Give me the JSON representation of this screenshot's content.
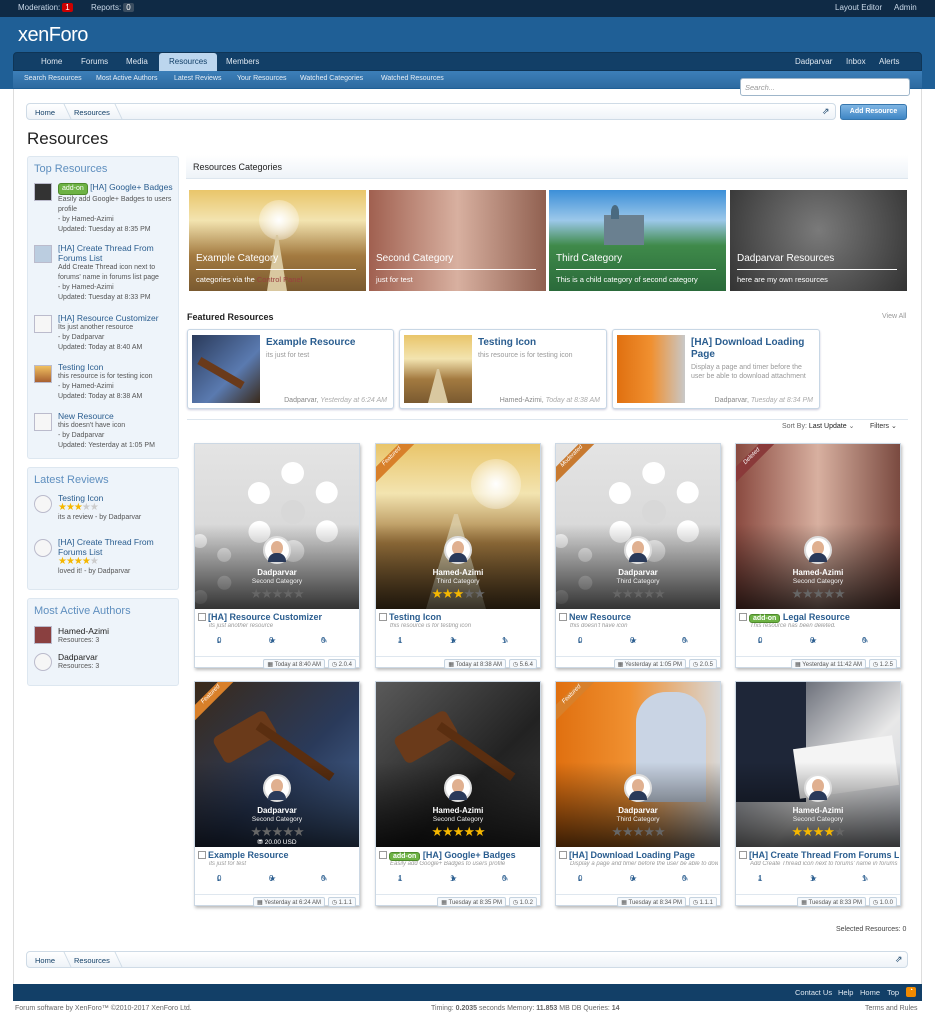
{
  "modbar": {
    "moderation_label": "Moderation:",
    "moderation_count": "1",
    "reports_label": "Reports:",
    "reports_count": "0",
    "layout_editor": "Layout Editor",
    "admin": "Admin"
  },
  "header": {
    "logo": "xenForo"
  },
  "nav": {
    "tabs": [
      "Home",
      "Forums",
      "Media",
      "Resources",
      "Members"
    ],
    "selected": "Resources",
    "user": "Dadparvar",
    "inbox": "Inbox",
    "alerts": "Alerts"
  },
  "subnav": [
    "Search Resources",
    "Most Active Authors",
    "Latest Reviews",
    "Your Resources",
    "Watched Categories",
    "Watched Resources"
  ],
  "search": {
    "placeholder": "Search..."
  },
  "breadcrumb": [
    "Home",
    "Resources"
  ],
  "add_button": "Add Resource",
  "page_title": "Resources",
  "sidebar": {
    "top_resources": {
      "title": "Top Resources",
      "items": [
        {
          "badge": "add-on",
          "title": "[HA] Google+ Badges",
          "desc": "Easily add Google+ Badges to users profile",
          "by": "- by Hamed-Azimi",
          "updated": "Updated: Tuesday at 8:35 PM"
        },
        {
          "title": "[HA] Create Thread From Forums List",
          "desc": "Add Create Thread icon next to forums' name in forums list page",
          "by": "- by Hamed-Azimi",
          "updated": "Updated: Tuesday at 8:33 PM"
        },
        {
          "title": "[HA] Resource Customizer",
          "desc": "Its just another resource",
          "by": "- by Dadparvar",
          "updated": "Updated: Today at 8:40 AM"
        },
        {
          "title": "Testing Icon",
          "desc": "this resource is for testing icon",
          "by": "- by Hamed-Azimi",
          "updated": "Updated: Today at 8:38 AM"
        },
        {
          "title": "New Resource",
          "desc": "this doesn't have icon",
          "by": "- by Dadparvar",
          "updated": "Updated: Yesterday at 1:05 PM"
        }
      ]
    },
    "latest_reviews": {
      "title": "Latest Reviews",
      "items": [
        {
          "title": "Testing Icon",
          "rating": 3,
          "text": "its a review",
          "by": "- by Dadparvar"
        },
        {
          "title": "[HA] Create Thread From Forums List",
          "rating": 4,
          "text": "loved it!",
          "by": "- by Dadparvar"
        }
      ]
    },
    "active_authors": {
      "title": "Most Active Authors",
      "items": [
        {
          "name": "Hamed-Azimi",
          "count": "Resources: 3"
        },
        {
          "name": "Dadparvar",
          "count": "Resources: 3"
        }
      ]
    }
  },
  "categories": {
    "title": "Resources Categories",
    "items": [
      {
        "name": "Example Category",
        "desc_prefix": "categories via the ",
        "desc_link": "Control Panel",
        "bg": "#c79a55"
      },
      {
        "name": "Second Category",
        "desc": "just for test",
        "bg": "#b98a7a"
      },
      {
        "name": "Third Category",
        "desc": "This is a child category of second category",
        "bg": "#4a9a6a"
      },
      {
        "name": "Dadparvar Resources",
        "desc": "here are my own resources",
        "bg": "#555555"
      }
    ]
  },
  "featured": {
    "title": "Featured Resources",
    "view_all": "View All",
    "items": [
      {
        "title": "Example Resource",
        "desc": "its just for test",
        "author": "Dadparvar,",
        "date": "Yesterday at 6:24 AM"
      },
      {
        "title": "Testing Icon",
        "desc": "this resource is for testing icon",
        "author": "Hamed-Azimi,",
        "date": "Today at 8:38 AM"
      },
      {
        "title": "[HA] Download Loading Page",
        "desc": "Display a page and timer before the user be able to download attachment",
        "author": "Dadparvar,",
        "date": "Tuesday at 8:34 PM"
      }
    ]
  },
  "sort": {
    "label": "Sort By:",
    "value": "Last Update",
    "filters": "Filters"
  },
  "resources": [
    {
      "title": "[HA] Resource Customizer",
      "desc": "its just another resource",
      "author": "Dadparvar",
      "category": "Second Category",
      "rating": 0,
      "downloads": "0",
      "reviews": "0",
      "updates": "0",
      "date": "Today at 8:40 AM",
      "version": "2.0.4",
      "ribbon": "",
      "badge": "",
      "price": "",
      "image": "gear"
    },
    {
      "title": "Testing Icon",
      "desc": "this resource is for testing icon",
      "author": "Hamed-Azimi",
      "category": "Third Category",
      "rating": 3,
      "downloads": "1",
      "reviews": "1",
      "updates": "1",
      "date": "Today at 8:38 AM",
      "version": "5.6.4",
      "ribbon": "Featured",
      "badge": "",
      "price": "",
      "image": "road"
    },
    {
      "title": "New Resource",
      "desc": "this doesn't have icon",
      "author": "Dadparvar",
      "category": "Third Category",
      "rating": 0,
      "downloads": "0",
      "reviews": "0",
      "updates": "0",
      "date": "Yesterday at 1:05 PM",
      "version": "2.0.5",
      "ribbon": "Moderated",
      "badge": "",
      "price": "",
      "image": "gear"
    },
    {
      "title": "Legal Resource",
      "desc": "This resource has been deleted.",
      "author": "Hamed-Azimi",
      "category": "Second Category",
      "rating": 0,
      "downloads": "0",
      "reviews": "0",
      "updates": "0",
      "date": "Yesterday at 11:42 AM",
      "version": "1.2.5",
      "ribbon": "Deleted",
      "badge": "add-on",
      "price": "",
      "image": "forest"
    },
    {
      "title": "Example Resource",
      "desc": "its just for test",
      "author": "Dadparvar",
      "category": "Second Category",
      "rating": 0,
      "downloads": "0",
      "reviews": "0",
      "updates": "0",
      "date": "Yesterday at 6:24 AM",
      "version": "1.1.1",
      "ribbon": "Featured",
      "badge": "",
      "price": "20.00 USD",
      "image": "gavel"
    },
    {
      "title": "[HA] Google+ Badges",
      "desc": "Easily add Google+ Badges to users profile",
      "author": "Hamed-Azimi",
      "category": "Second Category",
      "rating": 5,
      "downloads": "1",
      "reviews": "1",
      "updates": "0",
      "date": "Tuesday at 8:35 PM",
      "version": "1.0.2",
      "ribbon": "",
      "badge": "add-on",
      "price": "",
      "image": "gavel2"
    },
    {
      "title": "[HA] Download Loading Page",
      "desc": "Display a page and timer before the user be able to download attachment",
      "author": "Dadparvar",
      "category": "Third Category",
      "rating": 0,
      "downloads": "0",
      "reviews": "0",
      "updates": "0",
      "date": "Tuesday at 8:34 PM",
      "version": "1.1.1",
      "ribbon": "Featured",
      "badge": "",
      "price": "",
      "image": "orange"
    },
    {
      "title": "[HA] Create Thread From Forums List",
      "desc": "Add Create Thread icon next to forums' name in forums list page",
      "author": "Hamed-Azimi",
      "category": "Second Category",
      "rating": 4,
      "downloads": "1",
      "reviews": "1",
      "updates": "1",
      "date": "Tuesday at 8:33 PM",
      "version": "1.0.0",
      "ribbon": "",
      "badge": "",
      "price": "",
      "image": "suit"
    }
  ],
  "selected_resources": "Selected Resources: 0",
  "footer": {
    "links": [
      "Contact Us",
      "Help",
      "Home",
      "Top"
    ],
    "copyright": "Forum software by XenForo™ ©2010-2017 XenForo Ltd.",
    "timing_label": "Timing:",
    "timing": "0.2035",
    "timing_unit": "seconds",
    "memory_label": "Memory:",
    "memory": "11.853",
    "memory_unit": "MB",
    "queries_label": "DB Queries:",
    "queries": "14",
    "terms": "Terms and Rules"
  },
  "colors": {
    "header": "#1f5f96",
    "nav": "#123f67",
    "link": "#2a5d8f",
    "addon": "#6db244",
    "star": "#f5b700"
  }
}
